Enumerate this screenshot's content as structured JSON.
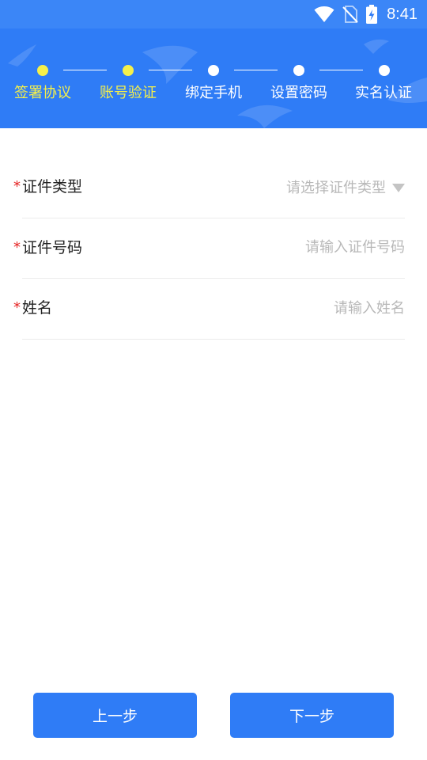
{
  "status_bar": {
    "time": "8:41",
    "icons": [
      "wifi-icon",
      "no-sim-icon",
      "battery-charging-icon"
    ]
  },
  "steps": [
    {
      "label": "签署协议",
      "state": "done"
    },
    {
      "label": "账号验证",
      "state": "current"
    },
    {
      "label": "绑定手机",
      "state": "pending"
    },
    {
      "label": "设置密码",
      "state": "pending"
    },
    {
      "label": "实名认证",
      "state": "pending"
    }
  ],
  "form": {
    "id_type": {
      "required_mark": "*",
      "label": "证件类型",
      "placeholder": "请选择证件类型"
    },
    "id_number": {
      "required_mark": "*",
      "label": "证件号码",
      "placeholder": "请输入证件号码",
      "value": ""
    },
    "name": {
      "required_mark": "*",
      "label": "姓名",
      "placeholder": "请输入姓名",
      "value": ""
    }
  },
  "buttons": {
    "prev_label": "上一步",
    "next_label": "下一步"
  },
  "colors": {
    "primary": "#2f7cf6",
    "active_step": "#f5f04a",
    "required": "#e52222"
  }
}
